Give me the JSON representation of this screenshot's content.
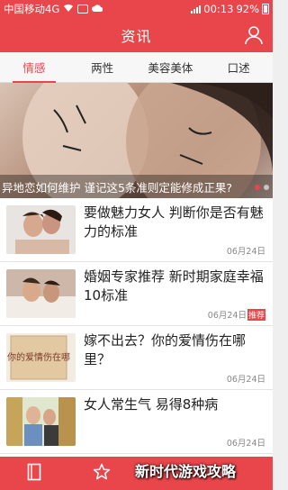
{
  "status": {
    "carrier": "中国移动4G",
    "time": "00:13",
    "battery": "92%"
  },
  "header": {
    "title": "资讯"
  },
  "tabs": [
    {
      "label": "情感",
      "active": true
    },
    {
      "label": "两性",
      "active": false
    },
    {
      "label": "美容美体",
      "active": false
    },
    {
      "label": "口述",
      "active": false
    }
  ],
  "banner": {
    "caption": "异地恋如何维护 谨记这5条准则定能修成正果?",
    "slides": 2,
    "active_slide": 1
  },
  "articles": [
    {
      "title": "要做魅力女人 判断你是否有魅力的标准",
      "date": "06月24日",
      "tag": ""
    },
    {
      "title": "婚姻专家推荐 新时期家庭幸福10标准",
      "date": "06月24日",
      "tag": "推荐"
    },
    {
      "title": "嫁不出去？你的爱情伤在哪里？",
      "date": "06月24日",
      "tag": "",
      "thumb_text": "你的爱情伤在哪"
    },
    {
      "title": "女人常生气 易得8种病",
      "date": "06月24日",
      "tag": ""
    }
  ],
  "bottom_nav": {
    "items": [
      "book-icon",
      "star-icon"
    ]
  },
  "watermark": "新时代游戏攻略",
  "colors": {
    "accent": "#e8464a"
  }
}
